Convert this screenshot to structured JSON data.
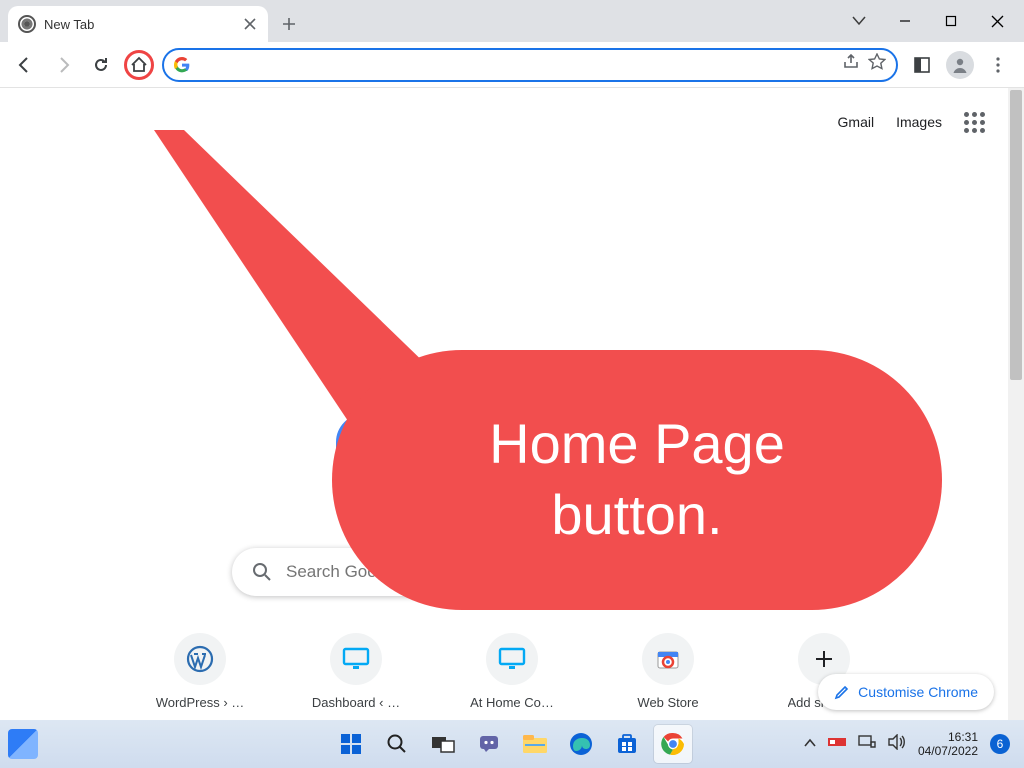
{
  "tab": {
    "title": "New Tab"
  },
  "toolbar": {
    "share": "share",
    "star": "star"
  },
  "omnibox": {
    "value": ""
  },
  "toplinks": {
    "gmail": "Gmail",
    "images": "Images"
  },
  "search": {
    "placeholder": "Search Google or type a URL",
    "visible_text": "Search Google o"
  },
  "shortcuts": [
    {
      "label": "WordPress › …",
      "icon": "wordpress"
    },
    {
      "label": "Dashboard ‹ …",
      "icon": "monitor"
    },
    {
      "label": "At Home Co…",
      "icon": "monitor"
    },
    {
      "label": "Web Store",
      "icon": "webstore"
    },
    {
      "label": "Add shortcut",
      "icon": "plus"
    }
  ],
  "customise": {
    "label": "Customise Chrome"
  },
  "callout": {
    "text_line1": "Home Page",
    "text_line2": "button."
  },
  "taskbar": {
    "time": "16:31",
    "date": "04/07/2022",
    "notifications": "6"
  }
}
